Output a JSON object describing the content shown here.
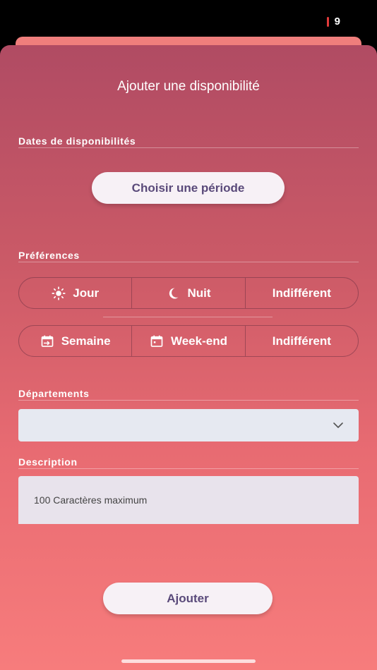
{
  "status_bar": {
    "battery_level": "9"
  },
  "modal": {
    "title": "Ajouter une disponibilité",
    "dates_section": {
      "label": "Dates de disponibilités",
      "choose_period_button": "Choisir une période"
    },
    "preferences_section": {
      "label": "Préférences",
      "time_of_day": [
        {
          "label": "Jour",
          "icon": "sun-icon"
        },
        {
          "label": "Nuit",
          "icon": "moon-icon"
        },
        {
          "label": "Indifférent",
          "icon": ""
        }
      ],
      "week_period": [
        {
          "label": "Semaine",
          "icon": "calendar-arrow-icon"
        },
        {
          "label": "Week-end",
          "icon": "calendar-icon"
        },
        {
          "label": "Indifférent",
          "icon": ""
        }
      ]
    },
    "departments_section": {
      "label": "Départements",
      "selected_value": ""
    },
    "description_section": {
      "label": "Description",
      "placeholder": "100 Caractères maximum"
    },
    "submit_button": "Ajouter"
  }
}
